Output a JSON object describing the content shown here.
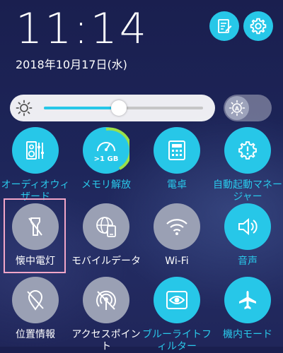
{
  "status": {
    "time": "11:14",
    "date": "2018年10月17日(水)"
  },
  "top_buttons": {
    "notes_icon": "notes-icon",
    "settings_icon": "gear-icon"
  },
  "brightness": {
    "level": 0.47,
    "auto_icon": "auto-brightness-icon"
  },
  "tiles": [
    {
      "label": "オーディオウィ\nザード",
      "icon": "audio-wizard-icon",
      "state": "on"
    },
    {
      "label": "メモリ解放",
      "icon": "speedometer-icon",
      "badge": ">1 GB",
      "state": "on"
    },
    {
      "label": "電卓",
      "icon": "calculator-icon",
      "state": "on"
    },
    {
      "label": "自動起動マネー\nジャー",
      "icon": "autostart-manager-icon",
      "state": "on"
    },
    {
      "label": "懐中電灯",
      "icon": "flashlight-off-icon",
      "state": "off"
    },
    {
      "label": "モバイルデータ",
      "icon": "mobile-data-icon",
      "state": "off"
    },
    {
      "label": "Wi-Fi",
      "icon": "wifi-icon",
      "state": "off"
    },
    {
      "label": "音声",
      "icon": "volume-icon",
      "state": "on"
    },
    {
      "label": "位置情報",
      "icon": "location-off-icon",
      "state": "off"
    },
    {
      "label": "アクセスポイント",
      "icon": "hotspot-off-icon",
      "state": "off"
    },
    {
      "label": "ブルーライトフ\nィルター",
      "icon": "eye-icon",
      "state": "on"
    },
    {
      "label": "機内モード",
      "icon": "airplane-icon",
      "state": "on"
    }
  ],
  "colors": {
    "accent": "#27c7e8",
    "tile_off": "#9aa0b4",
    "highlight": "#f2a6c8",
    "memory_ring": "#9be04a"
  }
}
